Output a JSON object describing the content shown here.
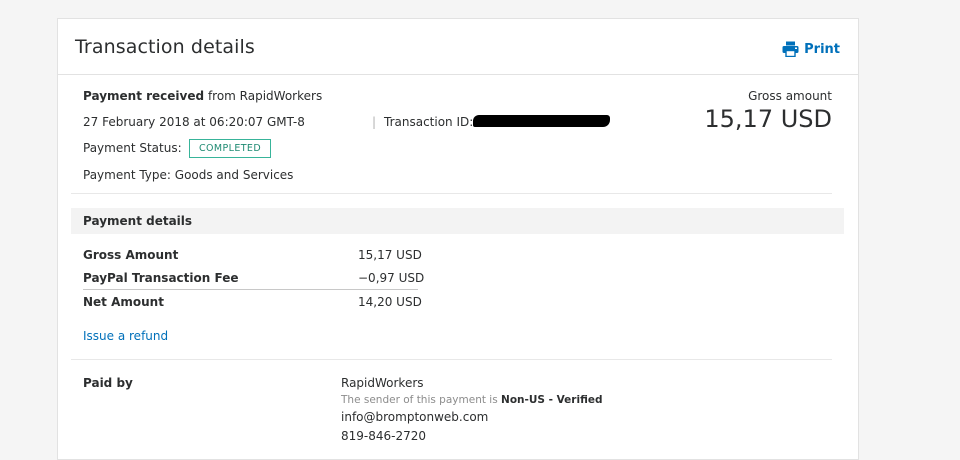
{
  "header": {
    "title": "Transaction details",
    "print_label": "Print"
  },
  "summary": {
    "payment_received_bold": "Payment received",
    "payment_received_rest": "from RapidWorkers",
    "date": "27 February 2018 at 06:20:07 GMT-8",
    "separator": "|",
    "transaction_id_label": "Transaction ID:",
    "status_label": "Payment Status:",
    "status_value": "COMPLETED",
    "type_label": "Payment Type: Goods and Services",
    "gross_label": "Gross amount",
    "gross_value": "15,17 USD"
  },
  "payment_details": {
    "heading": "Payment details",
    "rows": [
      {
        "label": "Gross Amount",
        "value": "15,17 USD"
      },
      {
        "label": "PayPal Transaction Fee",
        "value": "−0,97 USD"
      },
      {
        "label": "Net Amount",
        "value": "14,20 USD"
      }
    ],
    "refund_link": "Issue a refund"
  },
  "paid_by": {
    "label": "Paid by",
    "name": "RapidWorkers",
    "sender_note": "The sender of this payment is",
    "sender_status": "Non-US - Verified",
    "email": "info@bromptonweb.com",
    "phone": "819-846-2720"
  },
  "colors": {
    "accent": "#0070ba",
    "status_border": "#38b49a",
    "background": "#f5f5f5"
  },
  "icons": {
    "print": "printer-icon"
  }
}
